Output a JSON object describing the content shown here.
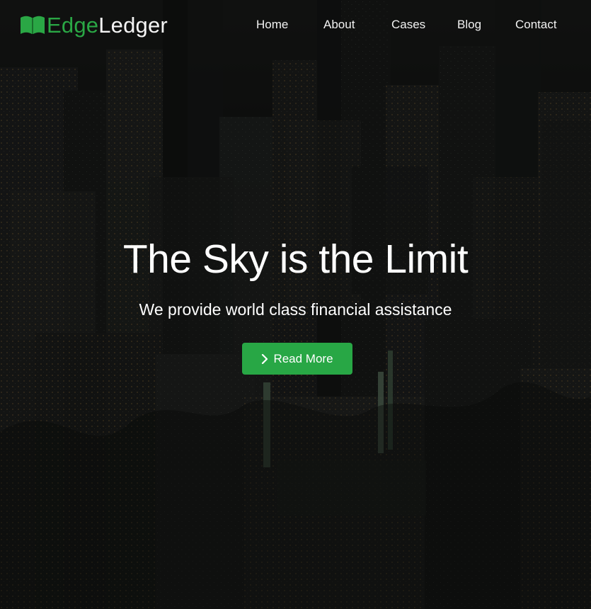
{
  "brand": {
    "first": "Edge",
    "second": "Ledger",
    "icon": "book-icon",
    "accent_color": "#2aa745"
  },
  "nav": {
    "items": [
      {
        "label": "Home"
      },
      {
        "label": "About"
      },
      {
        "label": "Cases"
      },
      {
        "label": "Blog"
      },
      {
        "label": "Contact"
      }
    ]
  },
  "hero": {
    "title": "The Sky is the Limit",
    "subtitle": "We provide world class financial assistance",
    "background": "night-city-skyline",
    "cta": {
      "label": "Read More",
      "icon": "chevron-right-icon",
      "color": "#28a745"
    }
  }
}
